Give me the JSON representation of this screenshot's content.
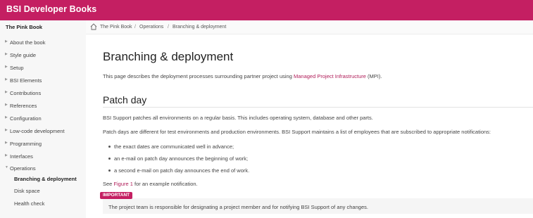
{
  "app": {
    "title": "BSI Developer Books"
  },
  "sidebar": {
    "book_title": "The Pink Book",
    "items": [
      {
        "label": "About the book"
      },
      {
        "label": "Style guide"
      },
      {
        "label": "Setup"
      },
      {
        "label": "BSI Elements"
      },
      {
        "label": "Contributions"
      },
      {
        "label": "References"
      },
      {
        "label": "Configuration"
      },
      {
        "label": "Low-code development"
      },
      {
        "label": "Programming"
      },
      {
        "label": "Interfaces"
      },
      {
        "label": "Operations"
      }
    ],
    "subitems": [
      {
        "label": "Branching & deployment",
        "active": true
      },
      {
        "label": "Disk space"
      },
      {
        "label": "Health check"
      }
    ]
  },
  "breadcrumb": {
    "items": [
      "The Pink Book",
      "Operations",
      "Branching & deployment"
    ],
    "separator": "/"
  },
  "content": {
    "title": "Branching & deployment",
    "intro_before": "This page describes the deployment processes surrounding partner project using ",
    "intro_link": "Managed Project Infrastructure",
    "intro_after": " (MPI).",
    "section_title": "Patch day",
    "para1": "BSI Support patches all environments on a regular basis. This includes operating system, database and other parts.",
    "para2": "Patch days are different for test environments and production environments. BSI Support maintains a list of employees that are subscribed to appropriate notifications:",
    "bullets": [
      "the exact dates are communicated well in advance;",
      "an e-mail on patch day announces the beginning of work;",
      "a second e-mail on patch day announces the end of work."
    ],
    "see_before": "See ",
    "see_link": "Figure 1",
    "see_after": " for an example notification.",
    "important_label": "IMPORTANT",
    "important_text": "The project team is responsible for designating a project member and for notifying BSI Support of any changes."
  },
  "colors": {
    "brand": "#c41f62",
    "link": "#b01c58"
  }
}
